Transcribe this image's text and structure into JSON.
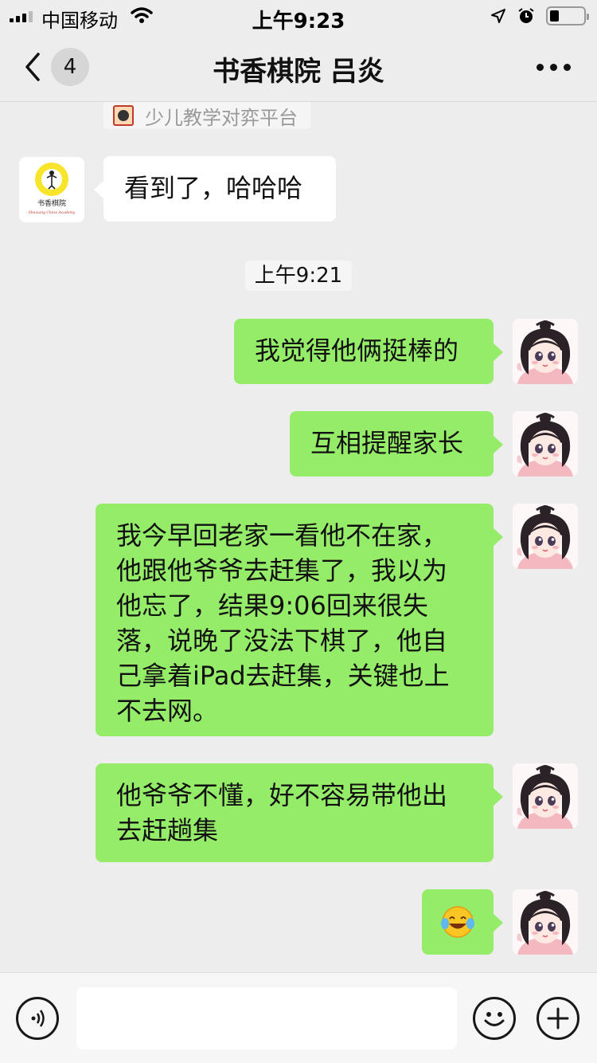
{
  "status_bar": {
    "carrier": "中国移动",
    "time": "上午9:23",
    "battery_level_percent": 26,
    "icons": [
      "signal-icon",
      "wifi-icon",
      "location-icon",
      "alarm-icon",
      "battery-icon"
    ]
  },
  "nav": {
    "unread_count": "4",
    "title": "书香棋院 吕炎",
    "icons": [
      "back-chevron-icon",
      "more-dots-icon"
    ]
  },
  "card_strip": {
    "label": "少儿教学对弈平台"
  },
  "school_avatar": {
    "name": "书香棋院",
    "subtitle": "Shuxiang Chess Academy"
  },
  "messages": [
    {
      "side": "left",
      "text": "看到了，哈哈哈"
    },
    {
      "side": "time",
      "text": "上午9:21"
    },
    {
      "side": "right",
      "text": "我觉得他俩挺棒的"
    },
    {
      "side": "right",
      "text": "互相提醒家长"
    },
    {
      "side": "right",
      "lines": [
        "我今早回老家一看他不在家，",
        "他跟他爷爷去赶集了，我以为",
        "他忘了，结果9:06回来很失",
        "落，说晚了没法下棋了，他自",
        "己拿着iPad去赶集，关键也上",
        "不去网。"
      ]
    },
    {
      "side": "right",
      "lines": [
        "他爷爷不懂，好不容易带他出",
        "去赶趟集"
      ]
    },
    {
      "side": "right",
      "emoji": "😂",
      "icon": "laughing-tears-emoji-icon"
    }
  ],
  "input_bar": {
    "value": "",
    "icons": [
      "voice-icon",
      "emoji-face-icon",
      "plus-icon"
    ]
  },
  "colors": {
    "background": "#ededed",
    "bubble_self": "#95ec69",
    "bubble_other": "#ffffff"
  }
}
